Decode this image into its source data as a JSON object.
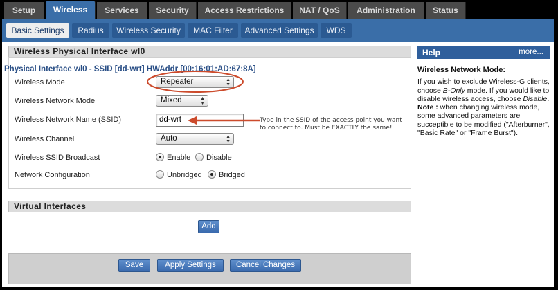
{
  "top_tabs": [
    {
      "label": "Setup",
      "active": false
    },
    {
      "label": "Wireless",
      "active": true
    },
    {
      "label": "Services",
      "active": false
    },
    {
      "label": "Security",
      "active": false
    },
    {
      "label": "Access Restrictions",
      "active": false
    },
    {
      "label": "NAT / QoS",
      "active": false
    },
    {
      "label": "Administration",
      "active": false
    },
    {
      "label": "Status",
      "active": false
    }
  ],
  "sub_tabs": [
    {
      "label": "Basic Settings",
      "active": true
    },
    {
      "label": "Radius",
      "active": false
    },
    {
      "label": "Wireless Security",
      "active": false
    },
    {
      "label": "MAC Filter",
      "active": false
    },
    {
      "label": "Advanced Settings",
      "active": false
    },
    {
      "label": "WDS",
      "active": false
    }
  ],
  "physical_section": {
    "header": "Wireless Physical Interface wl0",
    "interface_title": "Physical Interface wl0 - SSID [dd-wrt] HWAddr [00:16:01:AD:67:8A]",
    "rows": {
      "wireless_mode": {
        "label": "Wireless Mode",
        "value": "Repeater"
      },
      "network_mode": {
        "label": "Wireless Network Mode",
        "value": "Mixed"
      },
      "ssid": {
        "label": "Wireless Network Name (SSID)",
        "value": "dd-wrt"
      },
      "channel": {
        "label": "Wireless Channel",
        "value": "Auto"
      },
      "ssid_broadcast": {
        "label": "Wireless SSID Broadcast",
        "options": [
          "Enable",
          "Disable"
        ],
        "selected": "Enable"
      },
      "network_config": {
        "label": "Network Configuration",
        "options": [
          "Unbridged",
          "Bridged"
        ],
        "selected": "Bridged"
      }
    }
  },
  "annotation": {
    "line1": "Type in the SSID of the access point you want",
    "line2": "to connect to. Must be EXACTLY the same!",
    "color": "#cc4b2c"
  },
  "virtual_section": {
    "header": "Virtual Interfaces",
    "add_label": "Add"
  },
  "footer": {
    "save": "Save",
    "apply": "Apply Settings",
    "cancel": "Cancel Changes"
  },
  "help": {
    "title": "Help",
    "more": "more...",
    "heading": "Wireless Network Mode:",
    "p1_a": "If you wish to exclude Wireless-G clients, choose ",
    "p1_b": "B-Only",
    "p1_c": " mode. If you would like to disable wireless access, choose ",
    "p1_d": "Disable",
    "p1_e": ".",
    "note_label": "Note :",
    "note_text": " when changing wireless mode, some advanced parameters are succeptible to be modified (\"Afterburner\", \"Basic Rate\" or \"Frame Burst\")."
  }
}
